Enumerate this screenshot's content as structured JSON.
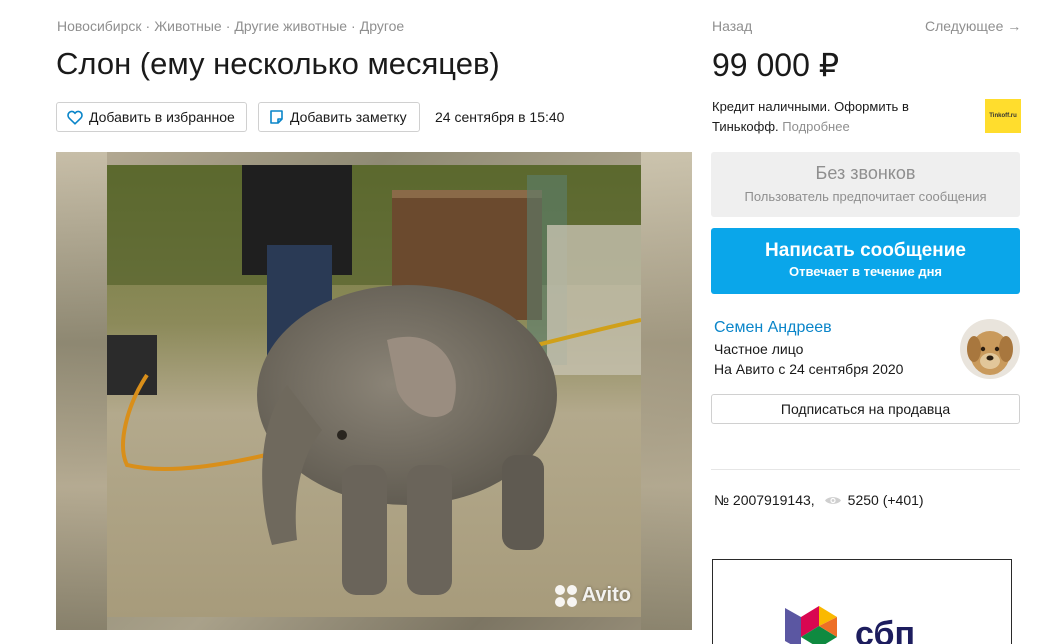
{
  "breadcrumb": {
    "items": [
      "Новосибирск",
      "Животные",
      "Другие животные",
      "Другое"
    ],
    "separator": "·"
  },
  "listing": {
    "title": "Слон (ему несколько месяцев)",
    "add_favorite_label": "Добавить в избранное",
    "add_note_label": "Добавить заметку",
    "published": "24 сентября в 15:40",
    "watermark": "Avito",
    "item_number": "№ 2007919143,",
    "views": "5250 (+401)"
  },
  "nav": {
    "back_label": "Назад",
    "next_label": "Следующее →"
  },
  "price": "99 000 ₽",
  "credit": {
    "text": "Кредит наличными. Оформить в Тинькофф.",
    "more_label": "Подробнее",
    "logo_text": "Tinkoff.ru"
  },
  "contact": {
    "no_calls_title": "Без звонков",
    "no_calls_subtitle": "Пользователь предпочитает сообщения",
    "message_button": "Написать сообщение",
    "message_subtitle": "Отвечает в течение дня"
  },
  "seller": {
    "name": "Семен Андреев",
    "type": "Частное лицо",
    "since": "На Авито с 24 сентября 2020",
    "subscribe_label": "Подписаться на продавца"
  },
  "banner": {
    "logo_text": "сбп"
  },
  "colors": {
    "accent": "#0aa6ea",
    "link": "#0a85c9",
    "muted": "#8f8f8f",
    "tinkoff": "#ffdd2d"
  },
  "icons": {
    "favorite": "heart-icon",
    "note": "note-icon",
    "views": "eye-icon"
  }
}
